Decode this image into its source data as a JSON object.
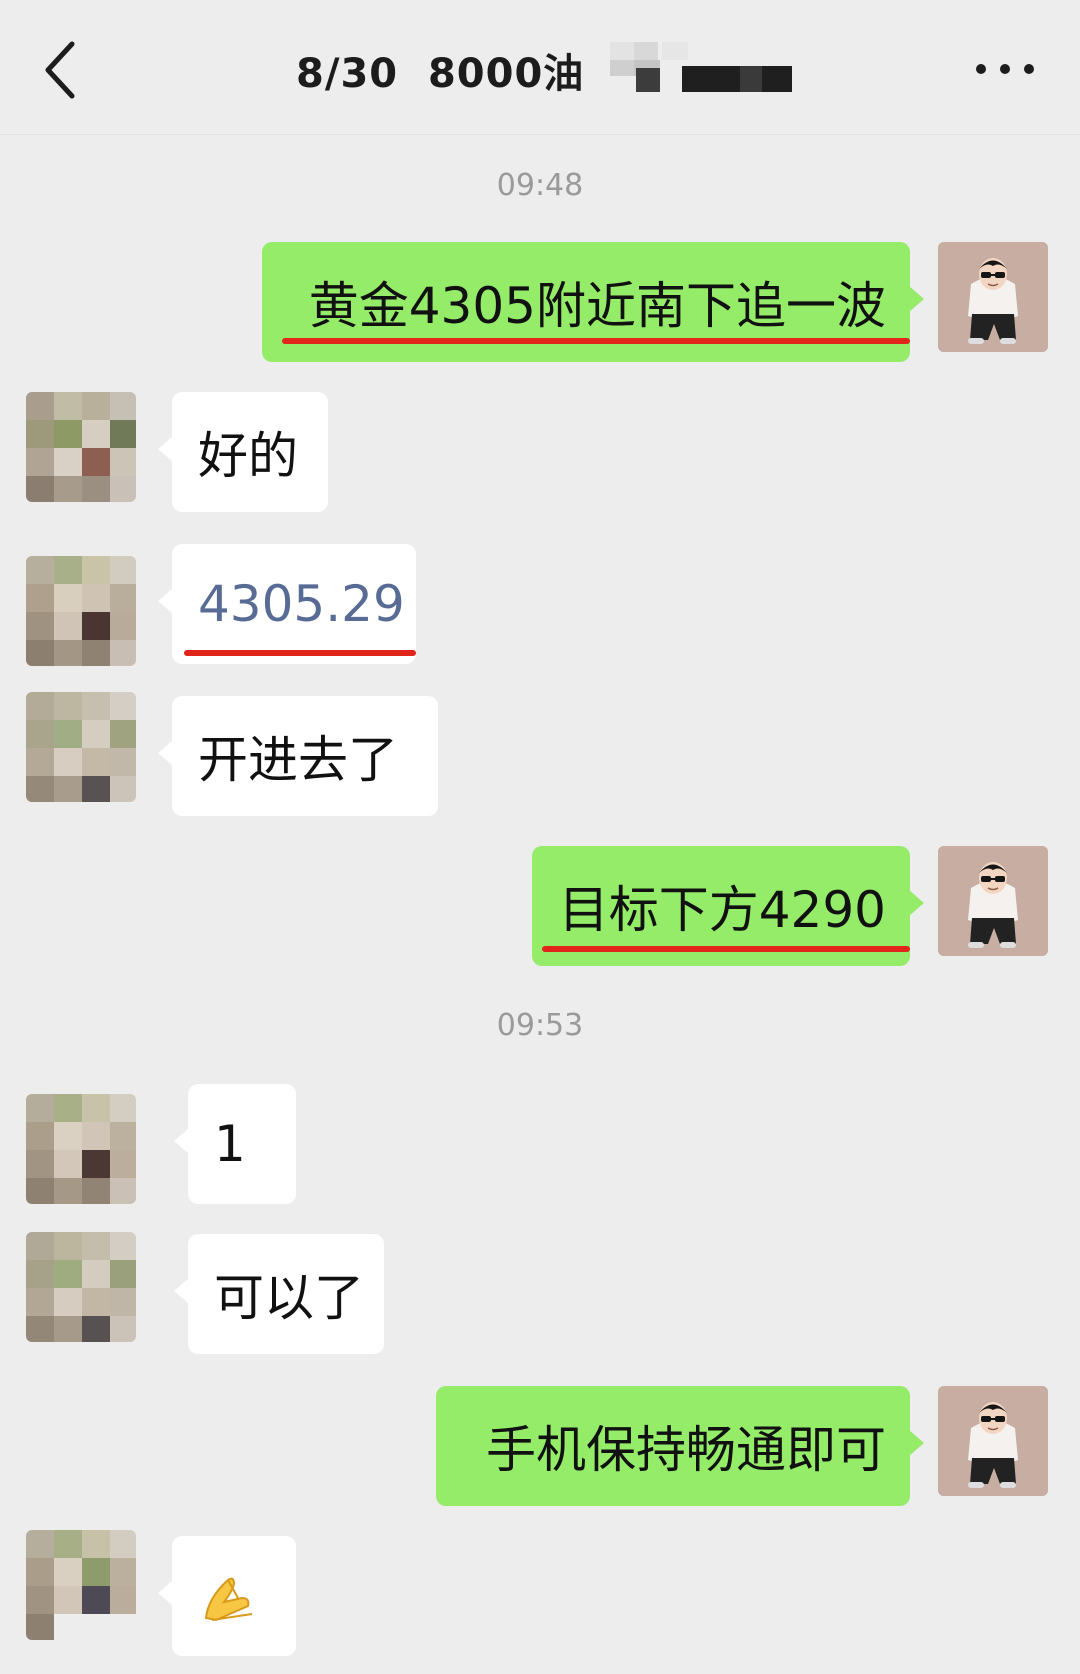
{
  "header": {
    "title": "8/30  8000油"
  },
  "messages": [
    {
      "type": "time",
      "text": "09:48"
    },
    {
      "side": "me",
      "text": "黄金4305附近南下追一波",
      "highlighted": true
    },
    {
      "side": "other",
      "text": "好的"
    },
    {
      "side": "other",
      "text": "4305.29",
      "highlighted": true
    },
    {
      "side": "other",
      "text": "开进去了"
    },
    {
      "side": "me",
      "text": "目标下方4290",
      "highlighted": true
    },
    {
      "type": "time",
      "text": "09:53"
    },
    {
      "side": "other",
      "text": "1"
    },
    {
      "side": "other",
      "text": "可以了"
    },
    {
      "side": "me",
      "text": "手机保持畅通即可"
    },
    {
      "side": "other",
      "emoji": "folded-hands"
    }
  ],
  "colors": {
    "background": "#ededed",
    "my_bubble": "#95ec69",
    "other_bubble": "#ffffff",
    "link_text": "#576b95",
    "highlight_underline": "#e1251b",
    "timestamp": "#9a9a9a"
  }
}
